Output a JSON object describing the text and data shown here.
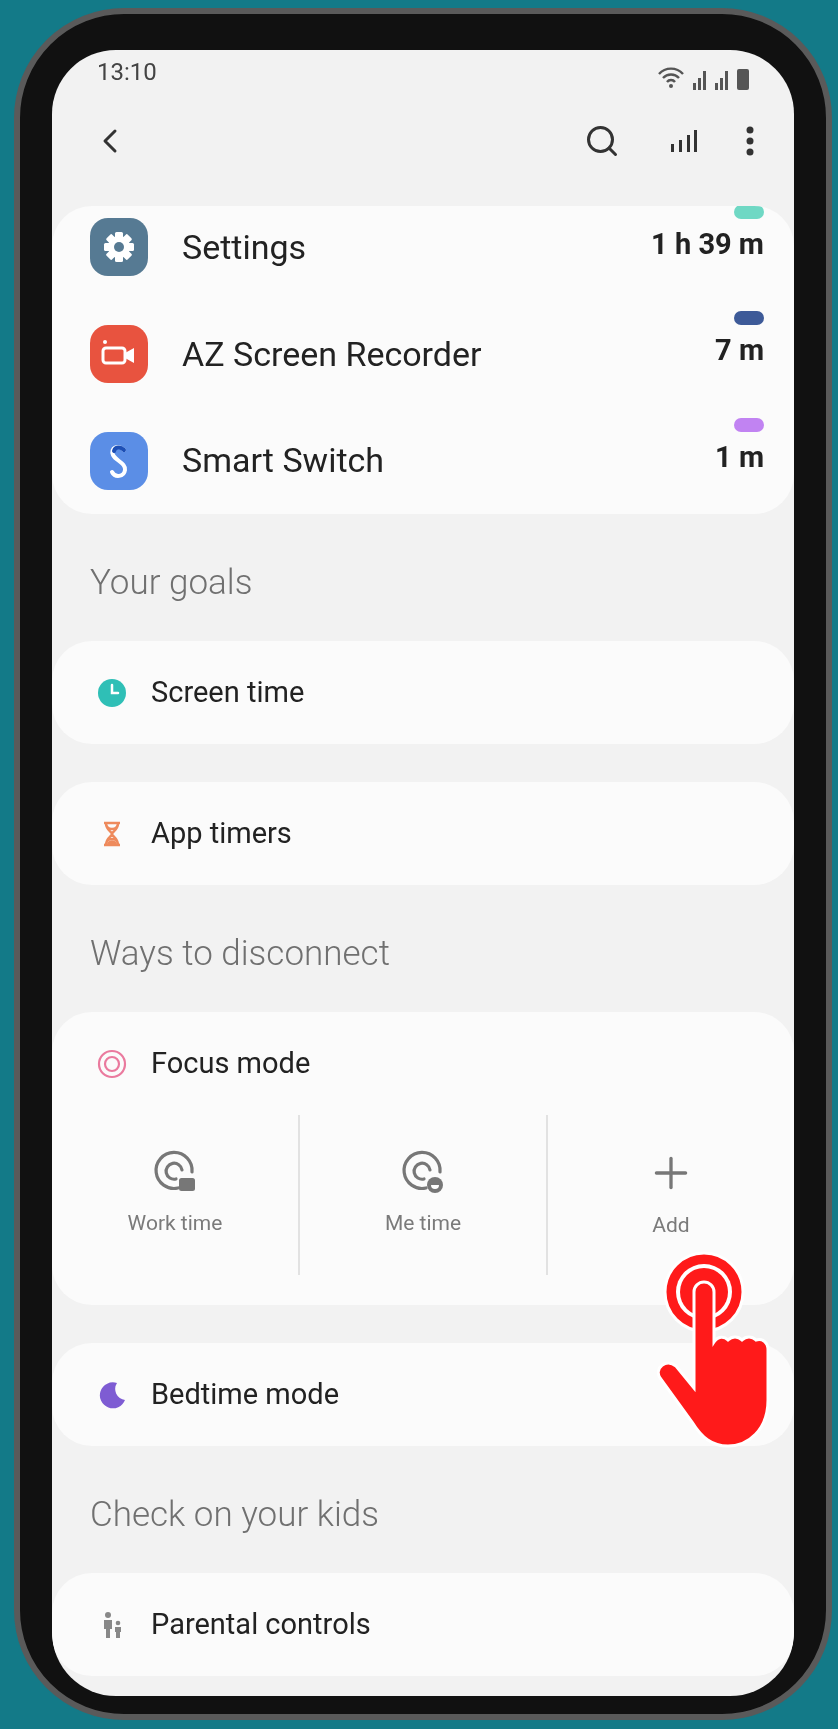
{
  "status_bar": {
    "time": "13:10"
  },
  "apps": [
    {
      "name": "Settings",
      "time": "1 h 39 m",
      "color": "#6fd8c4",
      "kind": "settings"
    },
    {
      "name": "AZ Screen Recorder",
      "time": "7 m",
      "color": "#3d5a98",
      "kind": "recorder"
    },
    {
      "name": "Smart Switch",
      "time": "1 m",
      "color": "#c183f2",
      "kind": "switch"
    }
  ],
  "sections": [
    {
      "title": "Your goals",
      "cards": [
        {
          "label": "Screen time",
          "kind": "clock"
        },
        {
          "label": "App timers",
          "kind": "hourglass"
        }
      ]
    },
    {
      "title": "Ways to disconnect",
      "cards": [
        {
          "label": "Focus mode",
          "kind": "focus",
          "options": [
            {
              "label": "Work time",
              "kind": "work"
            },
            {
              "label": "Me time",
              "kind": "me"
            },
            {
              "label": "Add",
              "kind": "add"
            }
          ]
        },
        {
          "label": "Bedtime mode",
          "kind": "moon"
        }
      ]
    },
    {
      "title": "Check on your kids",
      "cards": [
        {
          "label": "Parental controls",
          "kind": "family"
        }
      ]
    }
  ]
}
